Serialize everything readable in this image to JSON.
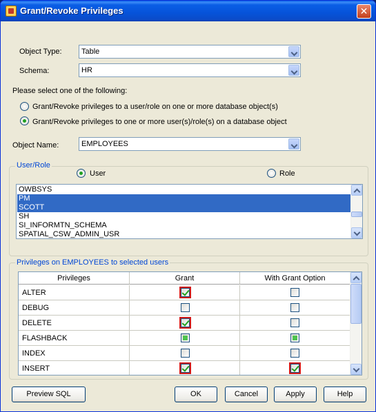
{
  "window": {
    "title": "Grant/Revoke Privileges"
  },
  "form": {
    "object_type_label": "Object Type:",
    "object_type_value": "Table",
    "schema_label": "Schema:",
    "schema_value": "HR",
    "select_prompt": "Please select one of the following:",
    "option1": "Grant/Revoke privileges to a user/role on one or more database object(s)",
    "option2": "Grant/Revoke privileges to one or more user(s)/role(s) on a database object",
    "object_name_label": "Object Name:",
    "object_name_value": "EMPLOYEES"
  },
  "user_role": {
    "title": "User/Role",
    "user_label": "User",
    "role_label": "Role",
    "items": [
      "OWBSYS",
      "PM",
      "SCOTT",
      "SH",
      "SI_INFORMTN_SCHEMA",
      "SPATIAL_CSW_ADMIN_USR"
    ]
  },
  "privileges": {
    "title": "Privileges on EMPLOYEES to selected users",
    "headers": [
      "Privileges",
      "Grant",
      "With Grant Option"
    ],
    "rows": [
      {
        "name": "ALTER",
        "grant": "checked",
        "grant_option": "unchecked"
      },
      {
        "name": "DEBUG",
        "grant": "unchecked",
        "grant_option": "unchecked"
      },
      {
        "name": "DELETE",
        "grant": "checked",
        "grant_option": "unchecked"
      },
      {
        "name": "FLASHBACK",
        "grant": "indeterminate",
        "grant_option": "indeterminate"
      },
      {
        "name": "INDEX",
        "grant": "unchecked",
        "grant_option": "unchecked"
      },
      {
        "name": "INSERT",
        "grant": "checked",
        "grant_option": "checked"
      }
    ]
  },
  "buttons": {
    "preview_sql": "Preview SQL",
    "ok": "OK",
    "cancel": "Cancel",
    "apply": "Apply",
    "help": "Help"
  }
}
